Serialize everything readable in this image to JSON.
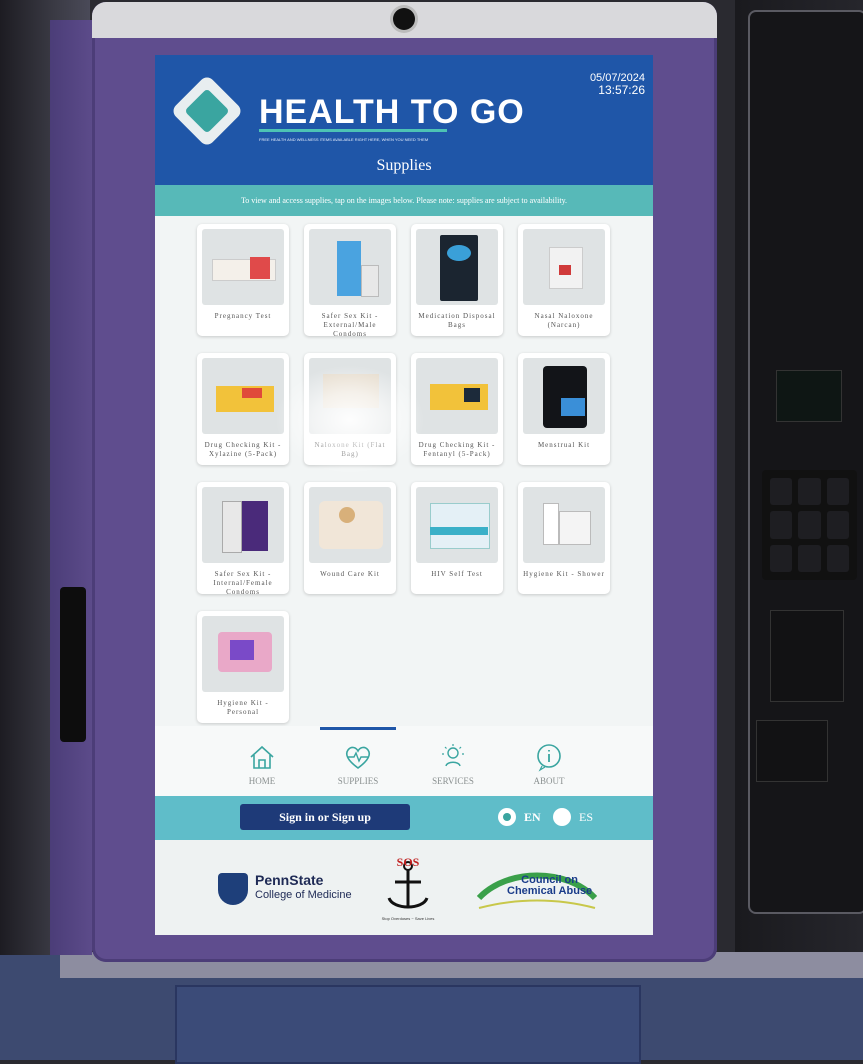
{
  "header": {
    "brand": "HEALTH TO GO",
    "tagline": "FREE HEALTH AND WELLNESS ITEMS AVAILABLE RIGHT HERE, WHEN YOU NEED THEM",
    "date": "05/07/2024",
    "time": "13:57:26",
    "page_title": "Supplies"
  },
  "instructions": "To view and access supplies, tap on the images below. Please note: supplies are subject to availability.",
  "products": [
    {
      "label": "Pregnancy Test"
    },
    {
      "label": "Safer Sex Kit - External/Male Condoms"
    },
    {
      "label": "Medication Disposal Bags"
    },
    {
      "label": "Nasal Naloxone (Narcan)"
    },
    {
      "label": "Drug Checking Kit - Xylazine (5-Pack)"
    },
    {
      "label": "Naloxone Kit (Flat Bag)"
    },
    {
      "label": "Drug Checking Kit - Fentanyl (5-Pack)"
    },
    {
      "label": "Menstrual Kit"
    },
    {
      "label": "Safer Sex Kit - Internal/Female Condoms"
    },
    {
      "label": "Wound Care Kit"
    },
    {
      "label": "HIV Self Test"
    },
    {
      "label": "Hygiene Kit - Shower"
    },
    {
      "label": "Hygiene Kit - Personal"
    }
  ],
  "nav": {
    "home": "HOME",
    "supplies": "SUPPLIES",
    "services": "SERVICES",
    "about": "ABOUT",
    "active": "SUPPLIES"
  },
  "account": {
    "signin_label": "Sign in or Sign up"
  },
  "language": {
    "en": "EN",
    "es": "ES",
    "selected": "EN"
  },
  "footer": {
    "psu_name": "PennState",
    "psu_sub": "College of Medicine",
    "sos_text": "SOS",
    "sos_ring": "Stop Overdoses ~ Save Lives",
    "cca_line1": "Council on",
    "cca_line2": "Chemical Abuse"
  },
  "colors": {
    "header_blue": "#1f56a8",
    "teal": "#57b9b8",
    "kiosk_purple": "#5f4d8e",
    "signin_navy": "#1e3a78"
  }
}
